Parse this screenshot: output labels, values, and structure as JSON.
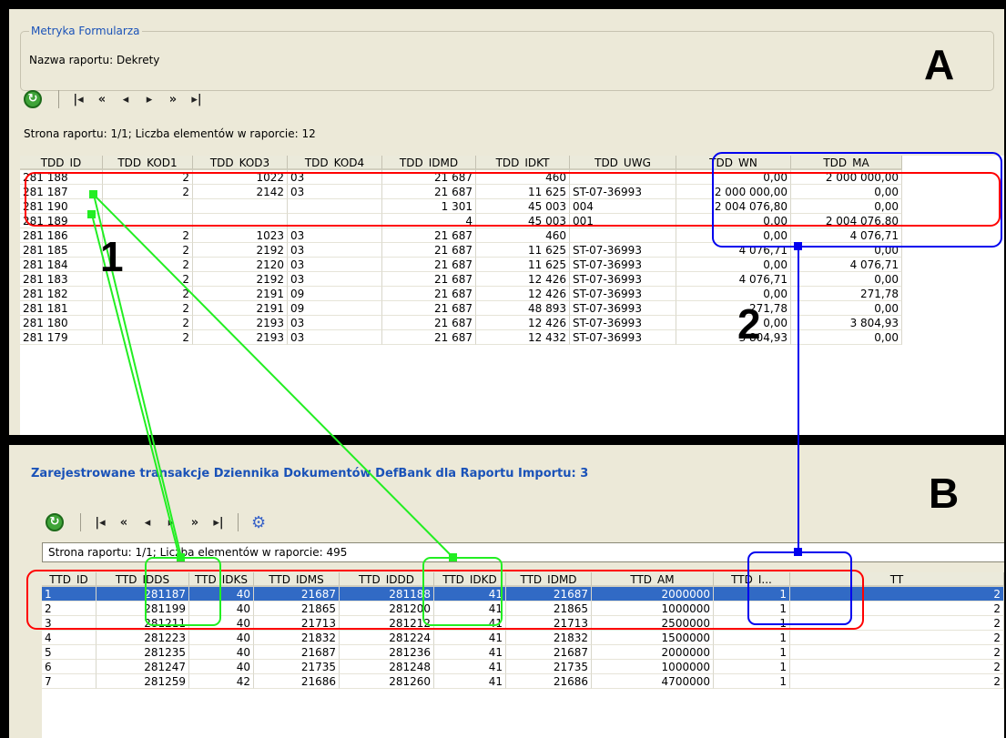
{
  "panel_a": {
    "legend": "Metryka Formularza",
    "report_name": "Nazwa raportu:  Dekrety",
    "label": "A",
    "status": "Strona raportu: 1/1; Liczba elementów w raporcie: 12",
    "columns": [
      "TDD_ID",
      "TDD_KOD1",
      "TDD_KOD3",
      "TDD_KOD4",
      "TDD_IDMD",
      "TDD_IDKT",
      "TDD_UWG",
      "TDD_WN",
      "TDD_MA"
    ],
    "rows": [
      [
        "281 188",
        "2",
        "1022",
        "03",
        "21 687",
        "460",
        "",
        "0,00",
        "2 000 000,00"
      ],
      [
        "281 187",
        "2",
        "2142",
        "03",
        "21 687",
        "11 625",
        "ST-07-36993",
        "2 000 000,00",
        "0,00"
      ],
      [
        "281 190",
        "",
        "",
        "",
        "1 301",
        "45 003",
        "004",
        "2 004 076,80",
        "0,00"
      ],
      [
        "281 189",
        "",
        "",
        "",
        "4",
        "45 003",
        "001",
        "0,00",
        "2 004 076,80"
      ],
      [
        "281 186",
        "2",
        "1023",
        "03",
        "21 687",
        "460",
        "",
        "0,00",
        "4 076,71"
      ],
      [
        "281 185",
        "2",
        "2192",
        "03",
        "21 687",
        "11 625",
        "ST-07-36993",
        "4 076,71",
        "0,00"
      ],
      [
        "281 184",
        "2",
        "2120",
        "03",
        "21 687",
        "11 625",
        "ST-07-36993",
        "0,00",
        "4 076,71"
      ],
      [
        "281 183",
        "2",
        "2192",
        "03",
        "21 687",
        "12 426",
        "ST-07-36993",
        "4 076,71",
        "0,00"
      ],
      [
        "281 182",
        "2",
        "2191",
        "09",
        "21 687",
        "12 426",
        "ST-07-36993",
        "0,00",
        "271,78"
      ],
      [
        "281 181",
        "2",
        "2191",
        "09",
        "21 687",
        "48 893",
        "ST-07-36993",
        "271,78",
        "0,00"
      ],
      [
        "281 180",
        "2",
        "2193",
        "03",
        "21 687",
        "12 426",
        "ST-07-36993",
        "0,00",
        "3 804,93"
      ],
      [
        "281 179",
        "2",
        "2193",
        "03",
        "21 687",
        "12 432",
        "ST-07-36993",
        "3 804,93",
        "0,00"
      ]
    ]
  },
  "panel_b": {
    "title": "Zarejestrowane transakcje Dziennika Dokumentów DefBank dla Raportu Importu: 3",
    "label": "B",
    "status": "Strona raportu: 1/1; Liczba elementów w raporcie: 495",
    "columns": [
      "TTD_ID",
      "TTD_IDDS",
      "TTD_IDKS",
      "TTD_IDMS",
      "TTD_IDDD",
      "TTD_IDKD",
      "TTD_IDMD",
      "TTD_AM",
      "TTD_I...",
      "TT"
    ],
    "rows": [
      [
        "1",
        "281187",
        "40",
        "21687",
        "281188",
        "41",
        "21687",
        "2000000",
        "1",
        "2"
      ],
      [
        "2",
        "281199",
        "40",
        "21865",
        "281200",
        "41",
        "21865",
        "1000000",
        "1",
        "2"
      ],
      [
        "3",
        "281211",
        "40",
        "21713",
        "281212",
        "41",
        "21713",
        "2500000",
        "1",
        "2"
      ],
      [
        "4",
        "281223",
        "40",
        "21832",
        "281224",
        "41",
        "21832",
        "1500000",
        "1",
        "2"
      ],
      [
        "5",
        "281235",
        "40",
        "21687",
        "281236",
        "41",
        "21687",
        "2000000",
        "1",
        "2"
      ],
      [
        "6",
        "281247",
        "40",
        "21735",
        "281248",
        "41",
        "21735",
        "1000000",
        "1",
        "2"
      ],
      [
        "7",
        "281259",
        "42",
        "21686",
        "281260",
        "41",
        "21686",
        "4700000",
        "1",
        "2"
      ]
    ]
  },
  "annotations": {
    "one_a": "1",
    "one_b": "1",
    "two": "2"
  },
  "colors": {
    "red": "#ff0000",
    "green": "#22ee22",
    "blue": "#0000ee",
    "selection": "#316ac5"
  }
}
